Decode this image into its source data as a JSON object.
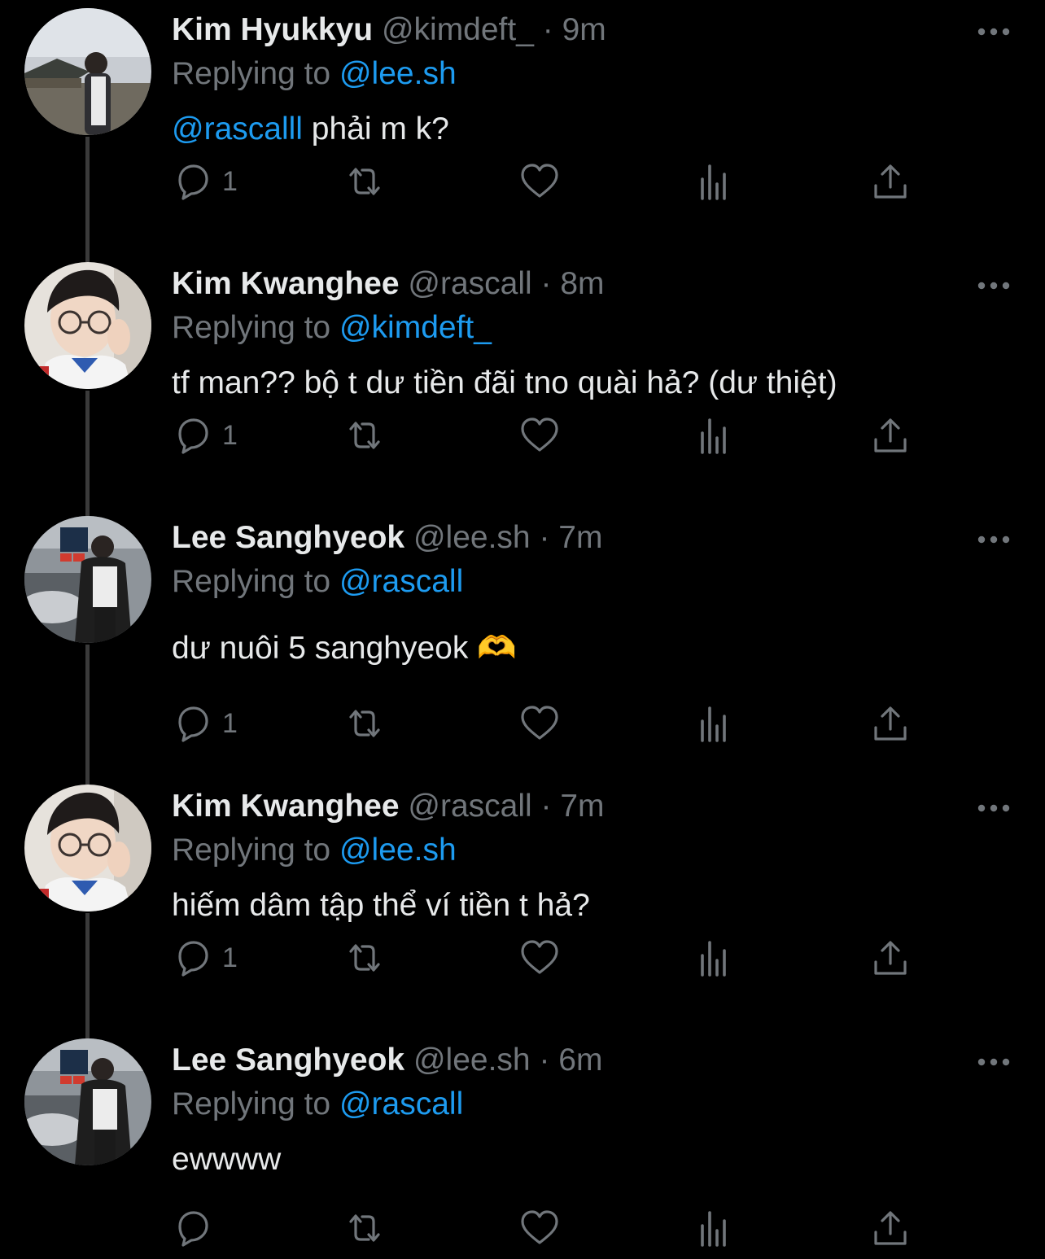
{
  "colors": {
    "background": "#000000",
    "text_primary": "#e7e9ea",
    "text_secondary": "#71767b",
    "accent_link": "#1d9bf0",
    "thread_line": "#3a3a3a"
  },
  "tweets": [
    {
      "display_name": "Kim Hyukkyu",
      "handle_time": "@kimdeft_ · 9m",
      "replying_prefix": "Replying to",
      "replying_handle": "@lee.sh",
      "body_mention": "@rascalll",
      "body_text": " phải m k?",
      "reply_count": "1",
      "avatar": "avatar-photo-kim-hyukkyu"
    },
    {
      "display_name": "Kim Kwanghee",
      "handle_time": "@rascall · 8m",
      "replying_prefix": "Replying to",
      "replying_handle": "@kimdeft_",
      "body_mention": "",
      "body_text": "tf man?? bộ t dư tiền đãi tno quài hả? (dư thiệt)",
      "reply_count": "1",
      "avatar": "avatar-photo-kim-kwanghee"
    },
    {
      "display_name": "Lee Sanghyeok",
      "handle_time": "@lee.sh · 7m",
      "replying_prefix": "Replying to",
      "replying_handle": "@rascall",
      "body_mention": "",
      "body_text": "dư nuôi 5 sanghyeok 🫶",
      "reply_count": "1",
      "avatar": "avatar-photo-lee-sanghyeok"
    },
    {
      "display_name": "Kim Kwanghee",
      "handle_time": "@rascall · 7m",
      "replying_prefix": "Replying to",
      "replying_handle": "@lee.sh",
      "body_mention": "",
      "body_text": "hiếm dâm tập thể ví tiền t hả?",
      "reply_count": "1",
      "avatar": "avatar-photo-kim-kwanghee"
    },
    {
      "display_name": "Lee Sanghyeok",
      "handle_time": "@lee.sh · 6m",
      "replying_prefix": "Replying to",
      "replying_handle": "@rascall",
      "body_mention": "",
      "body_text": "ewwww",
      "reply_count": "",
      "avatar": "avatar-photo-lee-sanghyeok"
    }
  ],
  "icons": {
    "more": "more-horizontal-icon",
    "reply": "reply-bubble-icon",
    "retweet": "retweet-icon",
    "like": "heart-icon",
    "views": "views-bar-chart-icon",
    "share": "share-upload-icon"
  }
}
